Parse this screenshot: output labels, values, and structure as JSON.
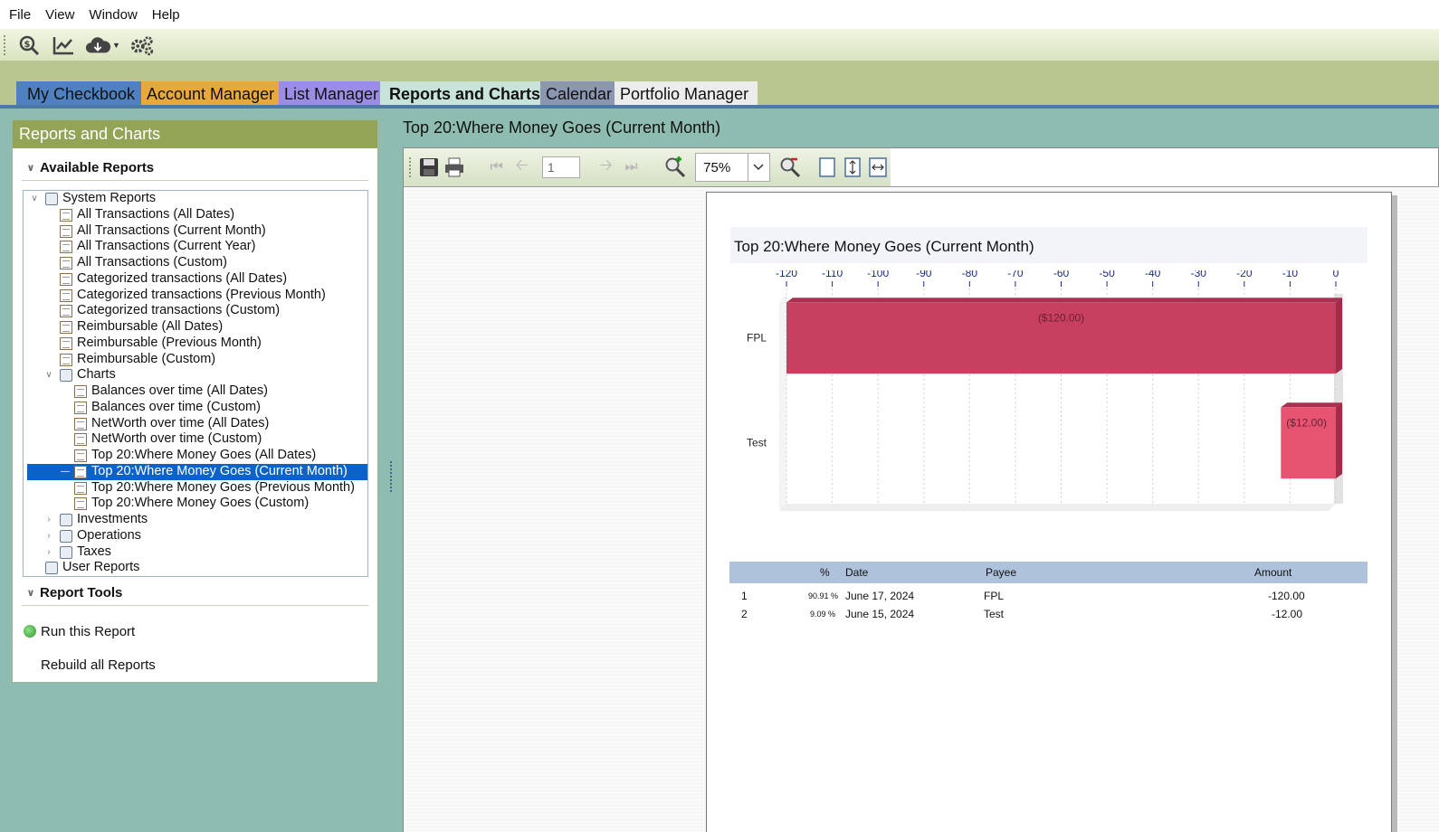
{
  "menu": {
    "items": [
      "File",
      "View",
      "Window",
      "Help"
    ]
  },
  "toolbar": {
    "icons": [
      "search-money-icon",
      "line-chart-icon",
      "cloud-download-icon",
      "settings-gears-icon"
    ]
  },
  "tabs": [
    "My Checkbook",
    "Account Manager",
    "List Manager",
    "Reports and Charts",
    "Calendar",
    "Portfolio Manager"
  ],
  "left_panel": {
    "title": "Reports and Charts",
    "available_reports": "Available Reports",
    "tree": {
      "system_reports": "System Reports",
      "reports": [
        "All Transactions (All Dates)",
        "All Transactions (Current Month)",
        "All Transactions (Current Year)",
        "All Transactions (Custom)",
        "Categorized transactions (All Dates)",
        "Categorized transactions (Previous Month)",
        "Categorized transactions (Custom)",
        "Reimbursable (All Dates)",
        "Reimbursable (Previous Month)",
        "Reimbursable (Custom)"
      ],
      "charts": "Charts",
      "chart_items": [
        "Balances over time (All Dates)",
        "Balances over time (Custom)",
        "NetWorth over time (All Dates)",
        "NetWorth over time (Custom)",
        "Top 20:Where Money Goes (All Dates)",
        "Top 20:Where Money Goes (Current Month)",
        "Top 20:Where Money Goes (Previous Month)",
        "Top 20:Where Money Goes (Custom)"
      ],
      "investments": "Investments",
      "operations": "Operations",
      "taxes": "Taxes",
      "user_reports": "User Reports"
    },
    "report_tools": "Report Tools",
    "run_report": "Run this Report",
    "rebuild_reports": "Rebuild all Reports"
  },
  "viewer": {
    "title": "Top 20:Where Money Goes (Current Month)",
    "page_number": "1",
    "zoom": "75%"
  },
  "chart_data": {
    "type": "bar",
    "orientation": "horizontal",
    "title": "Top 20:Where Money Goes (Current Month)",
    "categories": [
      "FPL",
      "Test"
    ],
    "values": [
      -120,
      -12
    ],
    "data_labels": [
      "($120.00)",
      "($12.00)"
    ],
    "xlim": [
      -120,
      0
    ],
    "ticks": [
      -120,
      -110,
      -100,
      -90,
      -80,
      -70,
      -60,
      -50,
      -40,
      -30,
      -20,
      -10,
      0
    ],
    "colors": [
      "#c8405f",
      "#e65472"
    ],
    "grid": true,
    "axis_position": "top"
  },
  "table": {
    "headers": [
      "%",
      "Date",
      "Payee",
      "Amount"
    ],
    "rows": [
      {
        "num": "1",
        "pct": "90.91 %",
        "date": "June 17, 2024",
        "payee": "FPL",
        "amount": "-120.00"
      },
      {
        "num": "2",
        "pct": "9.09 %",
        "date": "June 15, 2024",
        "payee": "Test",
        "amount": "-12.00"
      }
    ]
  }
}
